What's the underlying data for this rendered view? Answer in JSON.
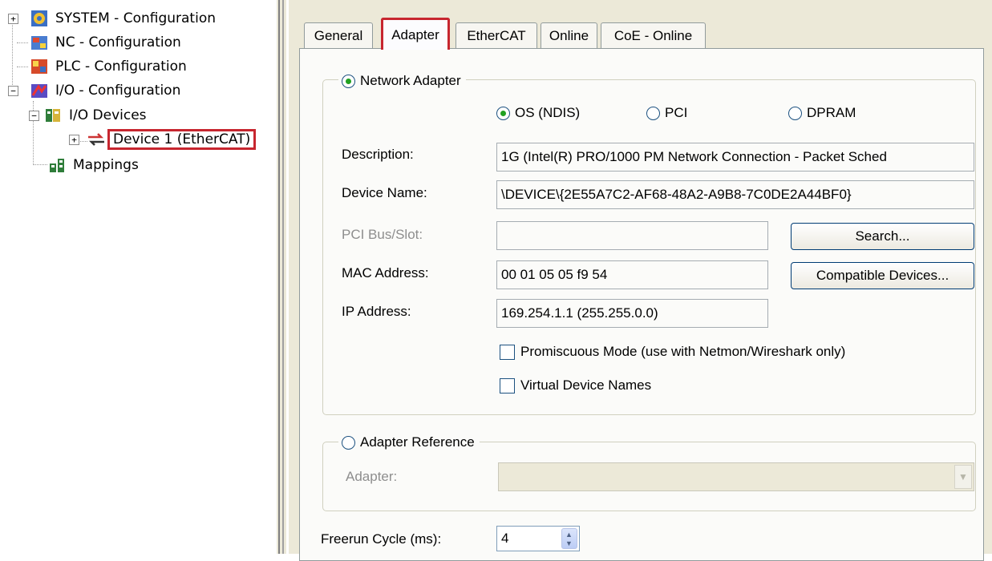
{
  "tree": {
    "items": [
      {
        "label": "SYSTEM - Configuration",
        "icon": "system-config-icon",
        "expander": "+"
      },
      {
        "label": "NC - Configuration",
        "icon": "nc-config-icon"
      },
      {
        "label": "PLC - Configuration",
        "icon": "plc-config-icon"
      },
      {
        "label": "I/O - Configuration",
        "icon": "io-config-icon",
        "expander": "−"
      },
      {
        "label": "I/O Devices",
        "icon": "io-devices-icon",
        "expander": "−"
      },
      {
        "label": "Device 1 (EtherCAT)",
        "icon": "ethercat-device-icon",
        "expander": "+",
        "selected": true
      },
      {
        "label": "Mappings",
        "icon": "mappings-icon"
      }
    ]
  },
  "tabs": [
    "General",
    "Adapter",
    "EtherCAT",
    "Online",
    "CoE - Online"
  ],
  "active_tab": "Adapter",
  "network_adapter": {
    "legend": "Network Adapter",
    "options": {
      "os": "OS (NDIS)",
      "pci": "PCI",
      "dpram": "DPRAM"
    },
    "selected_option": "OS (NDIS)",
    "description_label": "Description:",
    "description_value": "1G (Intel(R) PRO/1000 PM Network Connection - Packet Sched",
    "device_name_label": "Device Name:",
    "device_name_value": "\\DEVICE\\{2E55A7C2-AF68-48A2-A9B8-7C0DE2A44BF0}",
    "pci_bus_label": "PCI Bus/Slot:",
    "pci_bus_value": "",
    "search_button": "Search...",
    "mac_label": "MAC Address:",
    "mac_value": "00 01 05 05 f9 54",
    "compatible_button": "Compatible Devices...",
    "ip_label": "IP Address:",
    "ip_value": "169.254.1.1 (255.255.0.0)",
    "promiscuous_label": "Promiscuous Mode (use with Netmon/Wireshark only)",
    "virtual_names_label": "Virtual Device Names"
  },
  "adapter_reference": {
    "legend": "Adapter Reference",
    "adapter_label": "Adapter:",
    "adapter_value": ""
  },
  "freerun": {
    "label": "Freerun Cycle (ms):",
    "value": "4"
  },
  "colors": {
    "highlight_border": "#c7262f",
    "radio_dot": "#21a121",
    "panel_bg": "#ece9d8"
  }
}
